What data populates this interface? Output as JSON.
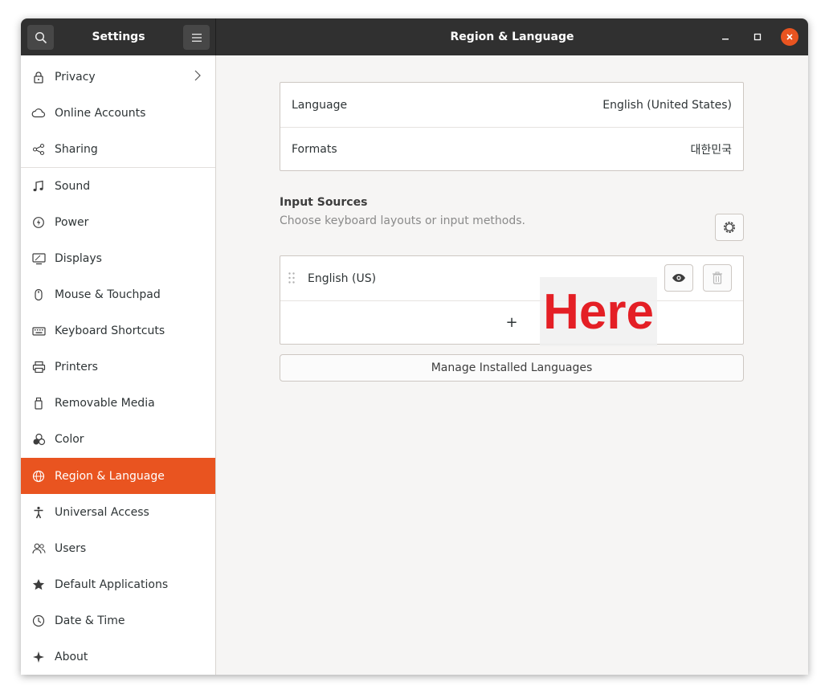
{
  "window": {
    "sidebar_title": "Settings",
    "main_title": "Region & Language",
    "accent_color": "#e95420"
  },
  "sidebar": {
    "items": [
      {
        "label": "Privacy",
        "icon": "lock-icon"
      },
      {
        "label": "Online Accounts",
        "icon": "cloud-icon"
      },
      {
        "label": "Sharing",
        "icon": "share-icon"
      },
      {
        "label": "Sound",
        "icon": "music-note-icon"
      },
      {
        "label": "Power",
        "icon": "power-icon"
      },
      {
        "label": "Displays",
        "icon": "display-icon"
      },
      {
        "label": "Mouse & Touchpad",
        "icon": "mouse-icon"
      },
      {
        "label": "Keyboard Shortcuts",
        "icon": "keyboard-icon"
      },
      {
        "label": "Printers",
        "icon": "printer-icon"
      },
      {
        "label": "Removable Media",
        "icon": "usb-drive-icon"
      },
      {
        "label": "Color",
        "icon": "color-icon"
      },
      {
        "label": "Region & Language",
        "icon": "globe-icon",
        "active": true
      },
      {
        "label": "Universal Access",
        "icon": "accessibility-icon"
      },
      {
        "label": "Users",
        "icon": "users-icon"
      },
      {
        "label": "Default Applications",
        "icon": "star-icon"
      },
      {
        "label": "Date & Time",
        "icon": "clock-icon"
      },
      {
        "label": "About",
        "icon": "sparkle-icon"
      }
    ]
  },
  "main": {
    "language": {
      "label": "Language",
      "value": "English (United States)"
    },
    "formats": {
      "label": "Formats",
      "value": "대한민국"
    },
    "input_sources": {
      "heading": "Input Sources",
      "subtitle": "Choose keyboard layouts or input methods.",
      "sources": [
        {
          "label": "English (US)"
        }
      ],
      "add_symbol": "+"
    },
    "manage_button": "Manage Installed Languages",
    "overlay_text": "Here"
  }
}
